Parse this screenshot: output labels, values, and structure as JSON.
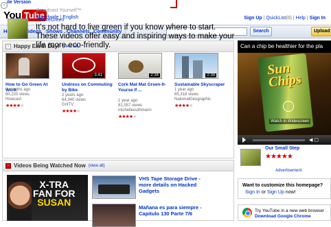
{
  "top": {
    "mobile_link": "ile Version",
    "logo_you": "You",
    "logo_tube": "Tube",
    "tagline": "Broadcast Yourself",
    "tagline_mark": "™",
    "region_worldwide": "Worldwide",
    "region_sep": "|",
    "region_language": "English",
    "sign_up": "Sign Up",
    "quicklist": "QuickList",
    "quicklist_count": "(0)",
    "help": "Help",
    "sep": "|",
    "sign_in": "Sign In"
  },
  "nav": {
    "tabs": [
      "Home",
      "Videos",
      "Shows",
      "Channels",
      "Community"
    ],
    "search_value": "",
    "search_button": "Search",
    "upload_button": "Upload"
  },
  "earth_day": {
    "title": "Happy Earth Day!",
    "view_all": "(view all)",
    "channel": "YTLiveGreen",
    "text": "It's not hard to live green if you know where to start. These videos offer easy and inspiring ways to make your life more eco-friendly.",
    "videos": [
      {
        "title": "How to Go Green At Work",
        "views": "8 months ago",
        "views2": "60,220 views",
        "user": "Howcast",
        "duration": "",
        "stars": 4
      },
      {
        "title": "Undress on Commuting by Bike",
        "views": "2 years ago",
        "views2": "64,340 views",
        "user": "GritTV",
        "duration": "3:41",
        "stars": 4
      },
      {
        "title": "Cork Mat Mat Green-It-Yourse lf ...",
        "views": "1 year ago",
        "views2": "81,557 views",
        "user": "michelleouthmann",
        "duration": "2:34",
        "stars": 4
      },
      {
        "title": "Sustainable Skyscraper",
        "views": "1 year ago",
        "views2": "65,318 views",
        "user": "NationalGeographic",
        "duration": "2:39",
        "stars": 4
      }
    ]
  },
  "ad": {
    "headline": "Can a chip be healthier for the pla",
    "brand_line1": "Sun",
    "brand_line2": "Chips",
    "watch_label": "Watch in Widescreen",
    "channel": "Our Small Step",
    "stars": "★★★★★",
    "label": "Advertisement"
  },
  "being_watched": {
    "title": "Videos Being Watched Now",
    "view_all": "(view all)",
    "big_thumb_line1": "X-TRA",
    "big_thumb_line2": "FAN FOR",
    "big_thumb_line3": "SUSAN",
    "items": [
      {
        "title": "VHS Tape Storage Drive - more details on Hacked Gadgets"
      },
      {
        "title": "Mañana es para siempre - Capitulo 130 Parte 7/6"
      }
    ]
  },
  "homepage_customize": {
    "question": "Want to customize this homepage?",
    "sign_in": "Sign In",
    "or": "or",
    "sign_up": "Sign Up",
    "now": "now!"
  },
  "chrome_promo": {
    "text": "Try YouTube in a new web browser",
    "link": "Download Google Chrome"
  }
}
